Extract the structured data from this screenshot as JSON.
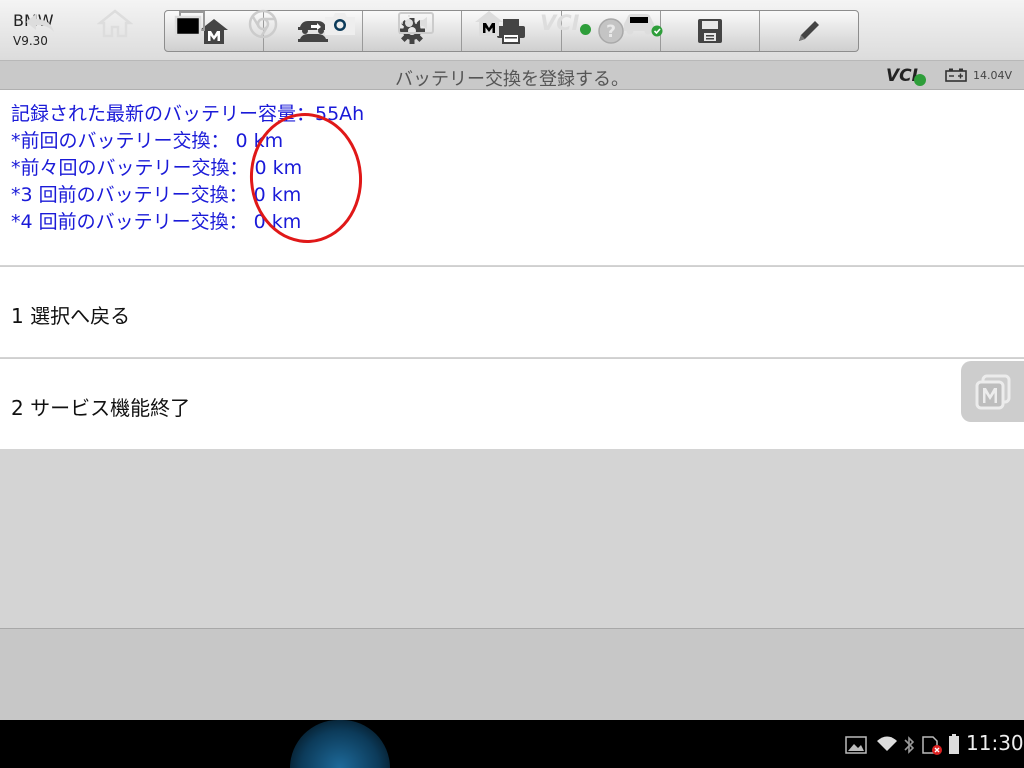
{
  "app": {
    "name": "BMW",
    "version": "V9.30"
  },
  "toolbar": {
    "buttons": [
      {
        "icon": "home-m-icon"
      },
      {
        "icon": "vehicle-swap-icon"
      },
      {
        "icon": "gear-icon"
      },
      {
        "icon": "printer-icon"
      },
      {
        "icon": "help-icon"
      },
      {
        "icon": "save-icon"
      },
      {
        "icon": "pencil-icon"
      }
    ]
  },
  "titlebar": {
    "title": "バッテリー交換を登録する。",
    "vci_label": "VCI",
    "voltage": "14.04V"
  },
  "info": {
    "lines": [
      "記録された最新のバッテリー容量：55Ah",
      "*前回のバッテリー交換： 0 km",
      "*前々回のバッテリー交換： 0 km",
      "*3 回前のバッテリー交換： 0 km",
      "*4 回前のバッテリー交換： 0 km"
    ]
  },
  "menu": {
    "items": [
      {
        "label": "1 選択へ戻る"
      },
      {
        "label": "2 サービス機能終了"
      }
    ]
  },
  "statusbar": {
    "time": "11:30",
    "nav_vci_label": "VCI"
  },
  "colors": {
    "info_text": "#1a1ad8",
    "highlight_circle": "#e01818",
    "ok_green": "#2e9e3a"
  }
}
